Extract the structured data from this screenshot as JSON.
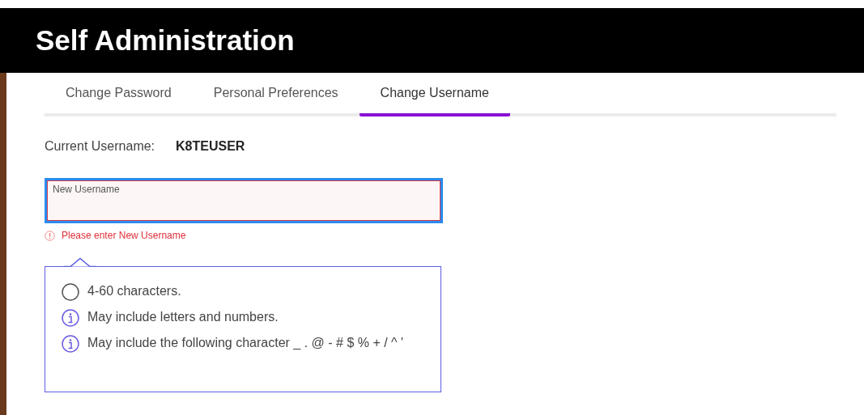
{
  "header": {
    "title": "Self Administration"
  },
  "tabs": [
    {
      "label": "Change Password",
      "selected": false
    },
    {
      "label": "Personal Preferences",
      "selected": false
    },
    {
      "label": "Change Username",
      "selected": true
    }
  ],
  "current_username": {
    "label": "Current Username:",
    "value": "K8TEUSER"
  },
  "new_username_field": {
    "label": "New Username",
    "focused": true,
    "error": true,
    "error_message": "Please enter New Username"
  },
  "rules": [
    {
      "kind": "pending",
      "text": "4-60 characters."
    },
    {
      "kind": "info",
      "text": "May include letters and numbers."
    },
    {
      "kind": "info",
      "text": "May include the following character _ . @ - # $ % + / ^ '"
    }
  ]
}
